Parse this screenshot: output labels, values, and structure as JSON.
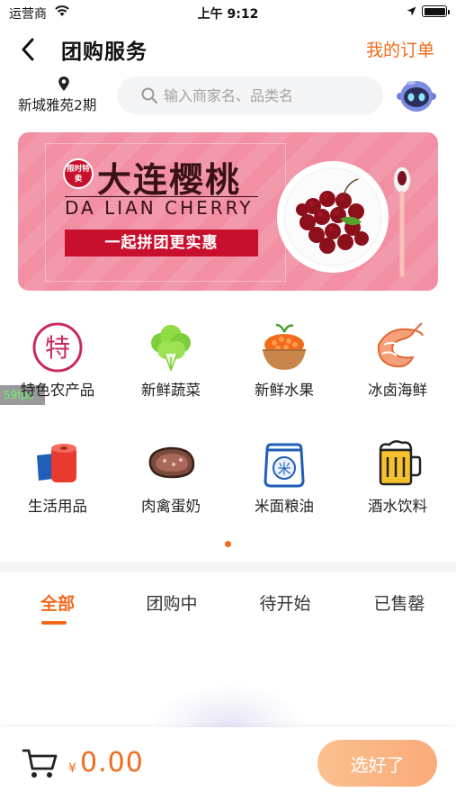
{
  "status_bar": {
    "carrier": "运营商",
    "time": "上午 9:12"
  },
  "nav": {
    "title": "团购服务",
    "my_orders": "我的订单"
  },
  "location": {
    "name": "新城雅苑2期"
  },
  "search": {
    "placeholder": "输入商家名、品类名"
  },
  "banner": {
    "badge": "限时特卖",
    "title": "大连樱桃",
    "subtitle": "DA LIAN CHERRY",
    "ribbon": "一起拼团更实惠"
  },
  "categories": [
    {
      "label": "特色农产品",
      "icon": "specialty-icon"
    },
    {
      "label": "新鲜蔬菜",
      "icon": "vegetable-icon"
    },
    {
      "label": "新鲜水果",
      "icon": "fruit-icon"
    },
    {
      "label": "冰卤海鲜",
      "icon": "seafood-icon"
    },
    {
      "label": "生活用品",
      "icon": "daily-goods-icon"
    },
    {
      "label": "肉禽蛋奶",
      "icon": "meat-icon"
    },
    {
      "label": "米面粮油",
      "icon": "rice-icon"
    },
    {
      "label": "酒水饮料",
      "icon": "beer-icon"
    }
  ],
  "fps_badge": "59fps",
  "tabs": [
    {
      "label": "全部",
      "active": true
    },
    {
      "label": "团购中",
      "active": false
    },
    {
      "label": "待开始",
      "active": false
    },
    {
      "label": "已售罄",
      "active": false
    }
  ],
  "footer": {
    "currency": "¥",
    "total": "0.00",
    "confirm": "选好了"
  },
  "colors": {
    "accent": "#f26a1b",
    "banner_pink": "#f38fa3",
    "ribbon_red": "#c8102e"
  }
}
